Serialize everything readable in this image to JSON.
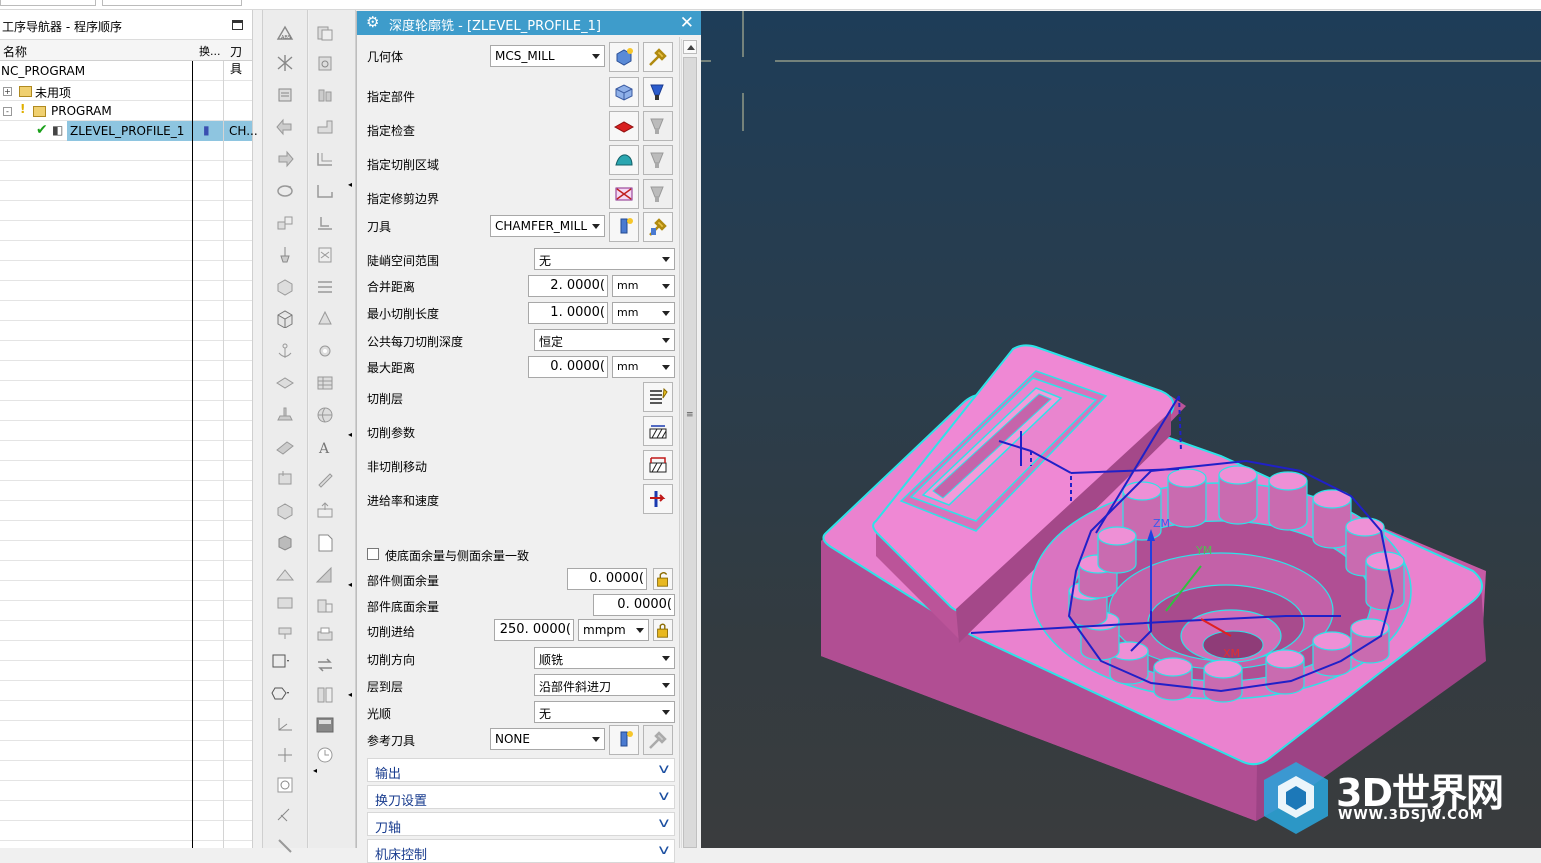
{
  "navigator": {
    "title": "工序导航器 - 程序顺序",
    "columns": {
      "name": "名称",
      "change": "换...",
      "tool": "刀具"
    },
    "rows": [
      {
        "label": "NC_PROGRAM"
      },
      {
        "label": "未用项"
      },
      {
        "label": "PROGRAM"
      },
      {
        "label": "ZLEVEL_PROFILE_1",
        "tool": "CH..."
      }
    ]
  },
  "dialog": {
    "title": "深度轮廓铣 - [ZLEVEL_PROFILE_1]",
    "geometry_label": "几何体",
    "geometry_value": "MCS_MILL",
    "specify_part": "指定部件",
    "specify_check": "指定检查",
    "specify_cut_area": "指定切削区域",
    "specify_trim": "指定修剪边界",
    "tool_label": "刀具",
    "tool_value": "CHAMFER_MILL",
    "steep_label": "陡峭空间范围",
    "steep_value": "无",
    "merge_label": "合并距离",
    "merge_value": "2. 0000(",
    "merge_unit": "mm",
    "min_cut_label": "最小切削长度",
    "min_cut_value": "1. 0000(",
    "min_cut_unit": "mm",
    "depth_label": "公共每刀切削深度",
    "depth_value": "恒定",
    "max_dist_label": "最大距离",
    "max_dist_value": "0. 0000(",
    "max_dist_unit": "mm",
    "cut_levels": "切削层",
    "cut_params": "切削参数",
    "non_cut": "非切削移动",
    "feeds": "进给率和速度",
    "floor_same": "使底面余量与侧面余量一致",
    "side_stock_label": "部件侧面余量",
    "side_stock_value": "0. 0000(",
    "floor_stock_label": "部件底面余量",
    "floor_stock_value": "0. 0000(",
    "feed_label": "切削进给",
    "feed_value": "250. 0000(",
    "feed_unit": "mmpm",
    "cut_dir_label": "切削方向",
    "cut_dir_value": "顺铣",
    "level_label": "层到层",
    "level_value": "沿部件斜进刀",
    "smooth_label": "光顺",
    "smooth_value": "无",
    "ref_tool_label": "参考刀具",
    "ref_tool_value": "NONE",
    "sections": [
      "输出",
      "换刀设置",
      "刀轴",
      "机床控制"
    ]
  },
  "viewport": {
    "axis_zm": "ZM",
    "axis_xm": "XM",
    "axis_ym": "YM"
  },
  "watermark": {
    "text": "3D世界网",
    "url": "WWW.3DSJW.COM"
  },
  "colors": {
    "title_bar": "#3e9ccb",
    "selection": "#8ec5e0",
    "part_face": "#ec7dc6",
    "part_edge": "#2de3e8",
    "toolpath": "#2020c8"
  }
}
